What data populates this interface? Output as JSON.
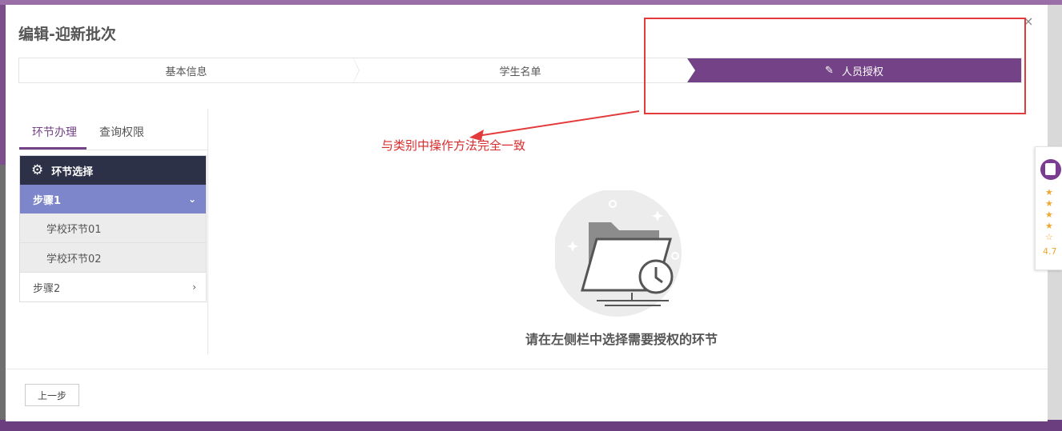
{
  "modal": {
    "title": "编辑-迎新批次",
    "close_label": "×"
  },
  "steps": [
    {
      "label": "基本信息"
    },
    {
      "label": "学生名单"
    },
    {
      "label": "人员授权",
      "active": true
    }
  ],
  "annotation": {
    "text": "与类别中操作方法完全一致",
    "color": "#d92b2b"
  },
  "left_tabs": [
    {
      "label": "环节办理",
      "active": true
    },
    {
      "label": "查询权限"
    }
  ],
  "menu": {
    "header": "环节选择",
    "steps": [
      {
        "label": "步骤1",
        "expanded": true,
        "children": [
          "学校环节01",
          "学校环节02"
        ]
      },
      {
        "label": "步骤2",
        "expanded": false
      }
    ]
  },
  "empty_state": {
    "text": "请在左侧栏中选择需要授权的环节",
    "icon": "folder-clock-icon"
  },
  "footer": {
    "prev_label": "上一步"
  },
  "rating_widget": {
    "score": "4.7",
    "stars": 5
  },
  "colors": {
    "accent": "#744286",
    "menu_header": "#2d3147",
    "menu_active": "#7d86ca"
  }
}
